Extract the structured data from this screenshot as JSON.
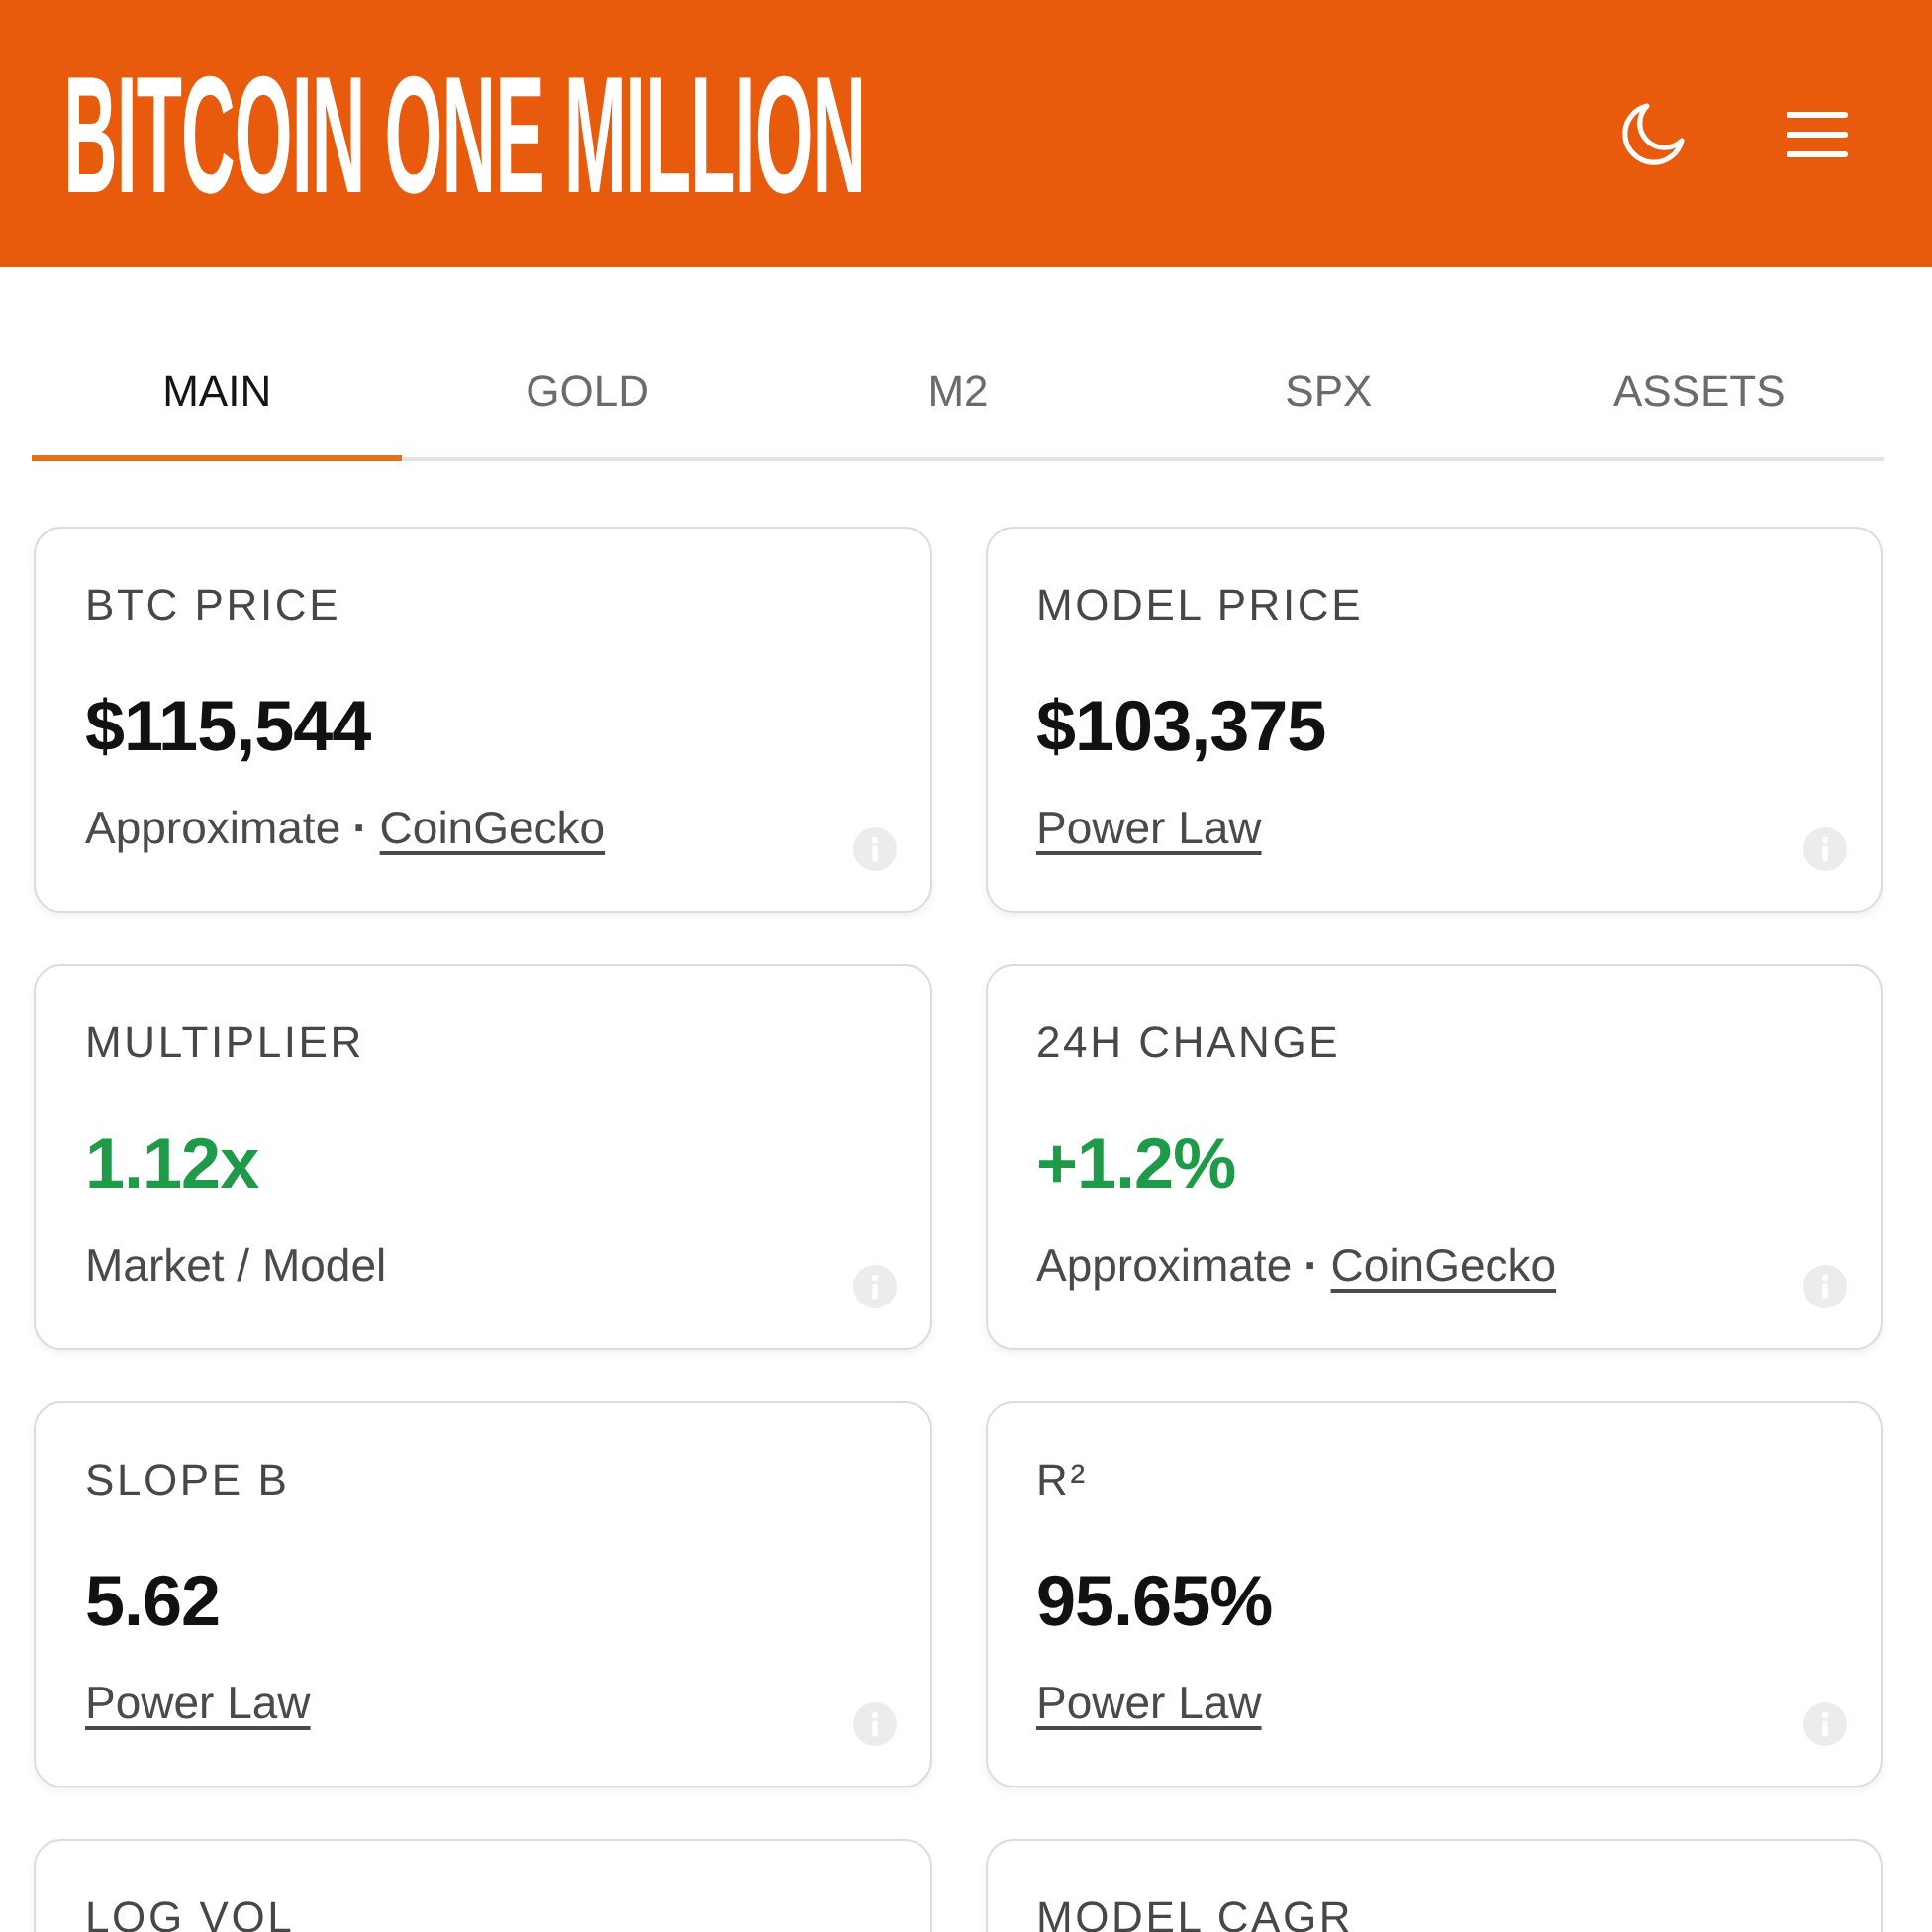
{
  "header": {
    "title": "BITCOIN ONE MILLION"
  },
  "tabs": [
    {
      "label": "MAIN",
      "selected": true
    },
    {
      "label": "GOLD",
      "selected": false
    },
    {
      "label": "M2",
      "selected": false
    },
    {
      "label": "SPX",
      "selected": false
    },
    {
      "label": "ASSETS",
      "selected": false
    }
  ],
  "cards": [
    {
      "label": "BTC PRICE",
      "value": "$115,544",
      "positive": false,
      "footer": [
        {
          "kind": "text",
          "text": "Approximate"
        },
        {
          "kind": "separator",
          "text": "·"
        },
        {
          "kind": "link",
          "text": "CoinGecko"
        }
      ]
    },
    {
      "label": "MODEL PRICE",
      "value": "$103,375",
      "positive": false,
      "footer": [
        {
          "kind": "link",
          "text": "Power Law"
        }
      ]
    },
    {
      "label": "MULTIPLIER",
      "value": "1.12x",
      "positive": true,
      "footer": [
        {
          "kind": "text",
          "text": "Market / Model"
        }
      ]
    },
    {
      "label": "24H CHANGE",
      "value": "+1.2%",
      "positive": true,
      "footer": [
        {
          "kind": "text",
          "text": "Approximate"
        },
        {
          "kind": "separator",
          "text": "·"
        },
        {
          "kind": "link",
          "text": "CoinGecko"
        }
      ]
    },
    {
      "label": "SLOPE B",
      "value": "5.62",
      "positive": false,
      "footer": [
        {
          "kind": "link",
          "text": "Power Law"
        }
      ]
    },
    {
      "label": "R²",
      "value": "95.65%",
      "positive": false,
      "footer": [
        {
          "kind": "link",
          "text": "Power Law"
        }
      ]
    },
    {
      "label": "LOG VOL"
    },
    {
      "label": "MODEL CAGR"
    }
  ]
}
